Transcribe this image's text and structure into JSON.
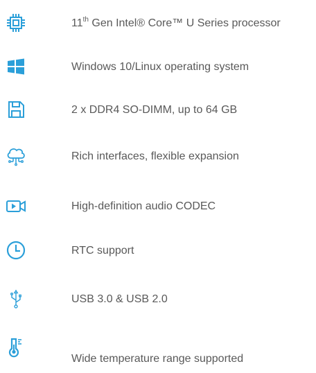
{
  "accent_color": "#2b9fd9",
  "text_color": "#595959",
  "features": [
    {
      "icon": "processor-chip-icon",
      "label_prefix": "11",
      "label_sup": "th",
      "label_rest": " Gen Intel® Core™ U Series processor"
    },
    {
      "icon": "windows-logo-icon",
      "label": "Windows 10/Linux operating system"
    },
    {
      "icon": "floppy-disk-icon",
      "label": "2 x DDR4 SO-DIMM, up to 64 GB"
    },
    {
      "icon": "cloud-network-icon",
      "label": "Rich interfaces, flexible expansion"
    },
    {
      "icon": "video-camera-icon",
      "label": "High-definition audio CODEC"
    },
    {
      "icon": "clock-icon",
      "label": "RTC support"
    },
    {
      "icon": "usb-icon",
      "label": "USB 3.0 & USB 2.0"
    },
    {
      "icon": "thermometer-icon",
      "label": "Wide temperature range supported"
    }
  ]
}
